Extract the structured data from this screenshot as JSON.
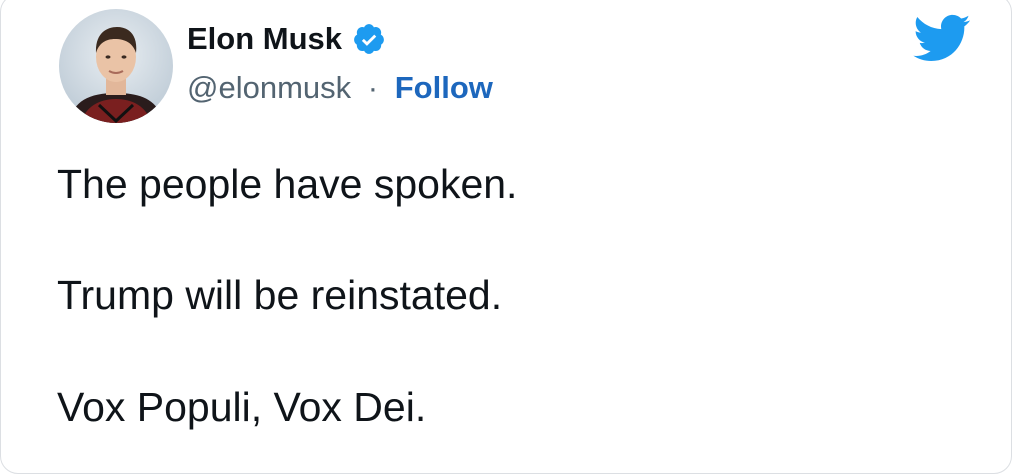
{
  "tweet": {
    "author": {
      "display_name": "Elon Musk",
      "handle": "@elonmusk",
      "separator": "·",
      "follow_label": "Follow",
      "verified": true,
      "avatar_icon": "profile-photo"
    },
    "lines": [
      "The people have spoken.",
      "Trump will be reinstated.",
      "Vox Populi, Vox Dei."
    ],
    "brand_icon": "twitter-bird-icon"
  },
  "colors": {
    "brand_blue": "#1d9bf0",
    "follow_blue": "#1d67bd",
    "handle_gray": "#536471",
    "text": "#0f1419"
  }
}
